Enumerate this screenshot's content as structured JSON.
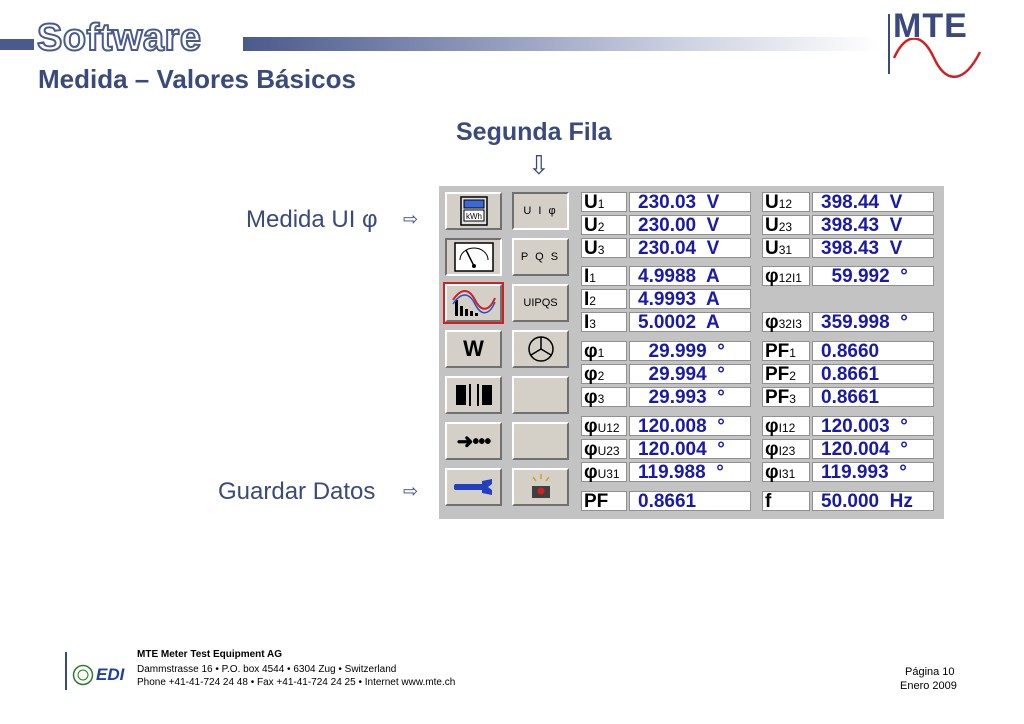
{
  "header": {
    "title": "Software",
    "subtitle": "Medida – Valores Básicos",
    "logo": "MTE"
  },
  "labels": {
    "segunda_fila": "Segunda Fila",
    "medida_ui": "Medida UI φ",
    "guardar_datos": "Guardar Datos"
  },
  "buttons": {
    "uiphi": "U I φ",
    "pqs": "P Q S",
    "uipqs": "UIPQS",
    "w": "W"
  },
  "measurements_left": [
    {
      "sym": "U",
      "sub": "1",
      "val": "230.03  V"
    },
    {
      "sym": "U",
      "sub": "2",
      "val": "230.00  V"
    },
    {
      "sym": "U",
      "sub": "3",
      "val": "230.04  V"
    },
    {
      "sym": "I",
      "sub": "1",
      "val": "4.9988  A"
    },
    {
      "sym": "I",
      "sub": "2",
      "val": "4.9993  A"
    },
    {
      "sym": "I",
      "sub": "3",
      "val": "5.0002  A"
    },
    {
      "sym": "φ",
      "sub": "1",
      "val": "  29.999  °"
    },
    {
      "sym": "φ",
      "sub": "2",
      "val": "  29.994  °"
    },
    {
      "sym": "φ",
      "sub": "3",
      "val": "  29.993  °"
    },
    {
      "sym": "φ",
      "sub": "U12",
      "val": "120.008  °"
    },
    {
      "sym": "φ",
      "sub": "U23",
      "val": "120.004  °"
    },
    {
      "sym": "φ",
      "sub": "U31",
      "val": "119.988  °"
    },
    {
      "sym": "PF",
      "sub": "",
      "val": "0.8661"
    }
  ],
  "measurements_right": [
    {
      "sym": "U",
      "sub": "12",
      "val": "398.44  V"
    },
    {
      "sym": "U",
      "sub": "23",
      "val": "398.43  V"
    },
    {
      "sym": "U",
      "sub": "31",
      "val": "398.43  V"
    },
    {
      "sym": "φ",
      "sub": "12I1",
      "val": "  59.992  °"
    },
    {
      "sym": "φ",
      "sub": "32I3",
      "val": "359.998  °"
    },
    {
      "sym": "PF",
      "sub": "1",
      "val": "0.8660"
    },
    {
      "sym": "PF",
      "sub": "2",
      "val": "0.8661"
    },
    {
      "sym": "PF",
      "sub": "3",
      "val": "0.8661"
    },
    {
      "sym": "φ",
      "sub": "I12",
      "val": "120.003  °"
    },
    {
      "sym": "φ",
      "sub": "I23",
      "val": "120.004  °"
    },
    {
      "sym": "φ",
      "sub": "I31",
      "val": "119.993  °"
    },
    {
      "sym": "f",
      "sub": "",
      "val": "50.000  Hz"
    }
  ],
  "footer": {
    "company": "MTE Meter Test Equipment AG",
    "address": "Dammstrasse 16 • P.O. box 4544 • 6304 Zug • Switzerland",
    "contact": "Phone +41-41-724 24 48 • Fax +41-41-724 24 25 • Internet www.mte.ch",
    "page": "Página 10",
    "date": "Enero 2009",
    "edi": "EDI"
  },
  "colors": {
    "primary": "#3a4a7c",
    "value_blue": "#1a1aa8",
    "selected_red": "#d02020",
    "wave_red": "#d02020"
  }
}
